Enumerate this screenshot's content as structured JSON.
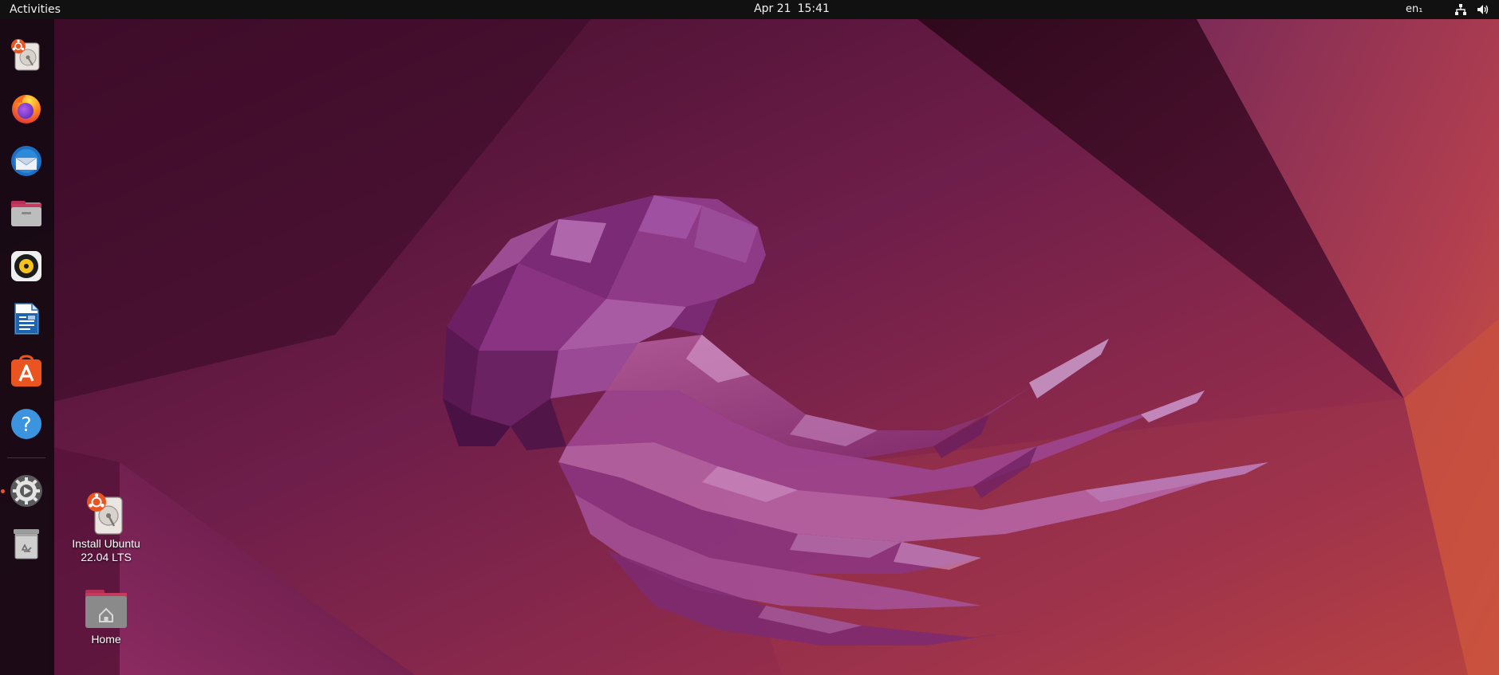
{
  "topbar": {
    "activities": "Activities",
    "date": "Apr 21",
    "time": "15:41",
    "keyboard_layout": "en₁",
    "tray_icons": [
      "network-icon",
      "volume-icon"
    ]
  },
  "dock": {
    "items": [
      {
        "name": "Install Ubuntu 22.04 LTS",
        "icon": "installer-icon"
      },
      {
        "name": "Firefox",
        "icon": "firefox-icon"
      },
      {
        "name": "Thunderbird",
        "icon": "thunderbird-icon"
      },
      {
        "name": "Files",
        "icon": "files-icon"
      },
      {
        "name": "Rhythmbox",
        "icon": "rhythmbox-icon"
      },
      {
        "name": "LibreOffice Writer",
        "icon": "writer-icon"
      },
      {
        "name": "Ubuntu Software",
        "icon": "software-icon"
      },
      {
        "name": "Help",
        "icon": "help-icon"
      },
      {
        "name": "Settings",
        "icon": "settings-icon",
        "running": true
      },
      {
        "name": "Trash",
        "icon": "trash-icon"
      }
    ]
  },
  "desktop": {
    "icons": [
      {
        "label_line1": "Install Ubuntu",
        "label_line2": "22.04 LTS",
        "icon": "installer-icon"
      },
      {
        "label_line1": "Home",
        "icon": "home-folder-icon"
      }
    ]
  },
  "colors": {
    "accent": "#e95420",
    "topbar_bg": "#111111",
    "dock_bg": "#160a12"
  }
}
